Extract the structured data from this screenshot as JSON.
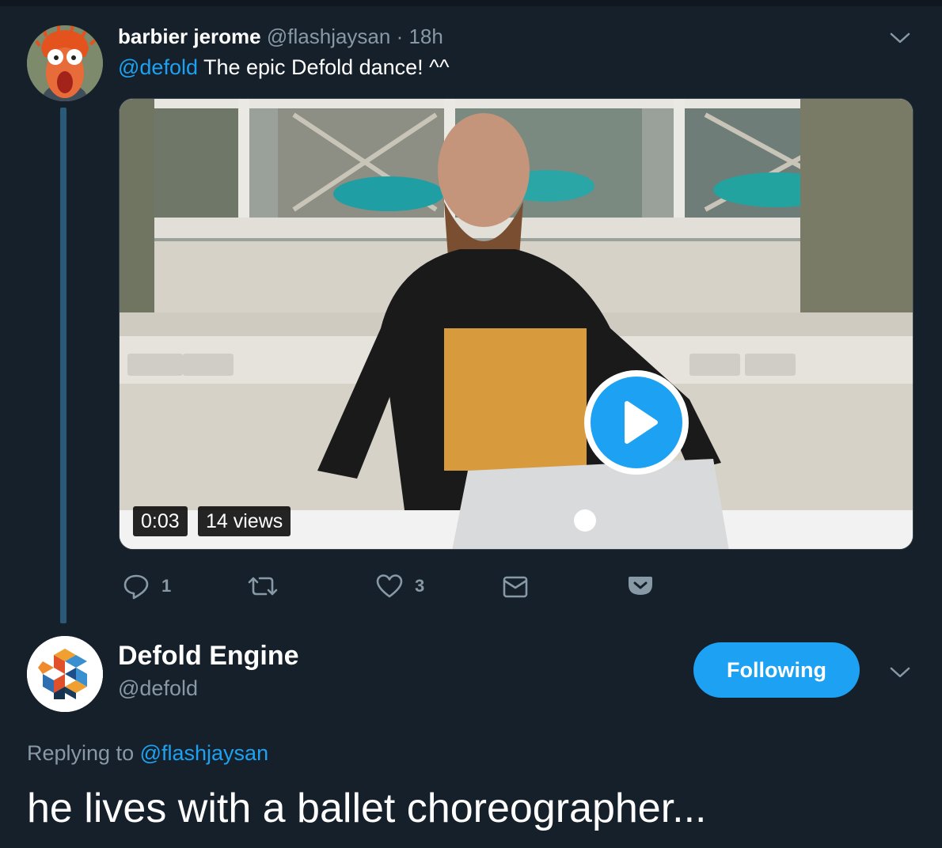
{
  "tweet1": {
    "display_name": "barbier jerome",
    "handle": "@flashjaysan",
    "separator": " · ",
    "time": "18h",
    "mention": "@defold",
    "text": " The epic Defold dance! ^^",
    "video": {
      "duration": "0:03",
      "views": "14 views"
    },
    "actions": {
      "reply_count": "1",
      "retweet_count": "",
      "like_count": "3"
    }
  },
  "tweet2": {
    "display_name": "Defold Engine",
    "handle": "@defold",
    "follow_label": "Following",
    "replying_prefix": "Replying to ",
    "replying_to": "@flashjaysan",
    "text": "he lives with a ballet choreographer..."
  },
  "colors": {
    "background": "#15202b",
    "accent": "#1da1f2",
    "muted": "#8899a6",
    "thread_line": "#2b5a78"
  },
  "icons": [
    "reply-icon",
    "retweet-icon",
    "heart-icon",
    "mail-icon",
    "pocket-icon",
    "chevron-down-icon",
    "play-icon"
  ]
}
